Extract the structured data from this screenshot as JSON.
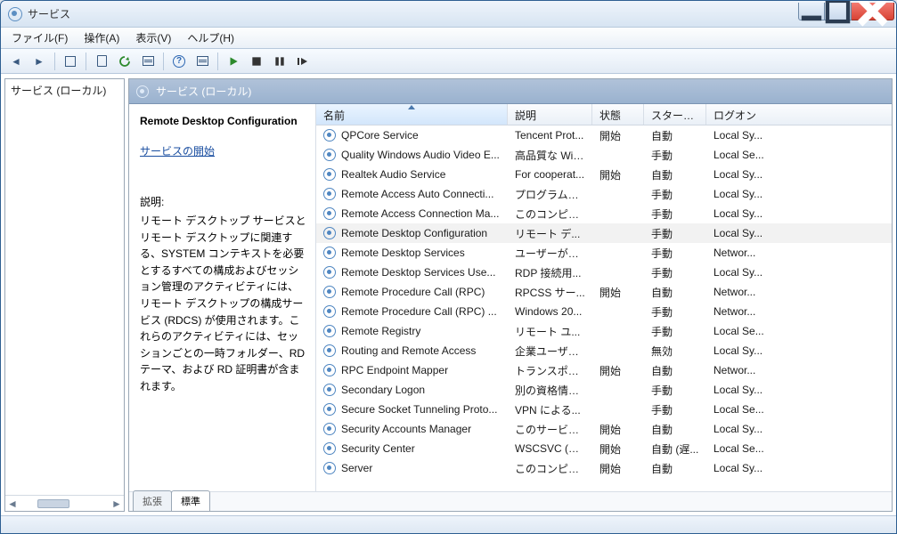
{
  "titlebar": {
    "title": "サービス"
  },
  "menu": {
    "file": "ファイル(F)",
    "action": "操作(A)",
    "view": "表示(V)",
    "help": "ヘルプ(H)"
  },
  "nav": {
    "root": "サービス (ローカル)"
  },
  "content": {
    "header": "サービス (ローカル)",
    "tabs": {
      "extended": "拡張",
      "standard": "標準"
    }
  },
  "detail": {
    "selected_name": "Remote Desktop Configuration",
    "start_link": "サービスの開始",
    "desc_label": "説明:",
    "desc_text": "リモート デスクトップ サービスとリモート デスクトップに関連する、SYSTEM コンテキストを必要とするすべての構成およびセッション管理のアクティビティには、リモート デスクトップの構成サービス (RDCS) が使用されます。これらのアクティビティには、セッションごとの一時フォルダー、RD テーマ、および RD 証明書が含まれます。"
  },
  "columns": {
    "name": "名前",
    "desc": "説明",
    "status": "状態",
    "startup": "スタート...",
    "logon": "ログオン"
  },
  "services": [
    {
      "name": "QPCore Service",
      "desc": "Tencent Prot...",
      "status": "開始",
      "startup": "自動",
      "logon": "Local Sy...",
      "selected": false
    },
    {
      "name": "Quality Windows Audio Video E...",
      "desc": "高品質な Win...",
      "status": "",
      "startup": "手動",
      "logon": "Local Se...",
      "selected": false
    },
    {
      "name": "Realtek Audio Service",
      "desc": "For cooperat...",
      "status": "開始",
      "startup": "自動",
      "logon": "Local Sy...",
      "selected": false
    },
    {
      "name": "Remote Access Auto Connecti...",
      "desc": "プログラムに...",
      "status": "",
      "startup": "手動",
      "logon": "Local Sy...",
      "selected": false
    },
    {
      "name": "Remote Access Connection Ma...",
      "desc": "このコンピュ...",
      "status": "",
      "startup": "手動",
      "logon": "Local Sy...",
      "selected": false
    },
    {
      "name": "Remote Desktop Configuration",
      "desc": "リモート デ...",
      "status": "",
      "startup": "手動",
      "logon": "Local Sy...",
      "selected": true
    },
    {
      "name": "Remote Desktop Services",
      "desc": "ユーザーがリ...",
      "status": "",
      "startup": "手動",
      "logon": "Networ...",
      "selected": false
    },
    {
      "name": "Remote Desktop Services Use...",
      "desc": "RDP 接続用...",
      "status": "",
      "startup": "手動",
      "logon": "Local Sy...",
      "selected": false
    },
    {
      "name": "Remote Procedure Call (RPC)",
      "desc": "RPCSS サー...",
      "status": "開始",
      "startup": "自動",
      "logon": "Networ...",
      "selected": false
    },
    {
      "name": "Remote Procedure Call (RPC) ...",
      "desc": "Windows 20...",
      "status": "",
      "startup": "手動",
      "logon": "Networ...",
      "selected": false
    },
    {
      "name": "Remote Registry",
      "desc": "リモート ユ...",
      "status": "",
      "startup": "手動",
      "logon": "Local Se...",
      "selected": false
    },
    {
      "name": "Routing and Remote Access",
      "desc": "企業ユーザー...",
      "status": "",
      "startup": "無効",
      "logon": "Local Sy...",
      "selected": false
    },
    {
      "name": "RPC Endpoint Mapper",
      "desc": "トランスポー...",
      "status": "開始",
      "startup": "自動",
      "logon": "Networ...",
      "selected": false
    },
    {
      "name": "Secondary Logon",
      "desc": "別の資格情報...",
      "status": "",
      "startup": "手動",
      "logon": "Local Sy...",
      "selected": false
    },
    {
      "name": "Secure Socket Tunneling Proto...",
      "desc": "VPN による...",
      "status": "",
      "startup": "手動",
      "logon": "Local Se...",
      "selected": false
    },
    {
      "name": "Security Accounts Manager",
      "desc": "このサービス...",
      "status": "開始",
      "startup": "自動",
      "logon": "Local Sy...",
      "selected": false
    },
    {
      "name": "Security Center",
      "desc": "WSCSVC (W...",
      "status": "開始",
      "startup": "自動 (遅...",
      "logon": "Local Se...",
      "selected": false
    },
    {
      "name": "Server",
      "desc": "このコンピュ...",
      "status": "開始",
      "startup": "自動",
      "logon": "Local Sy...",
      "selected": false
    }
  ]
}
